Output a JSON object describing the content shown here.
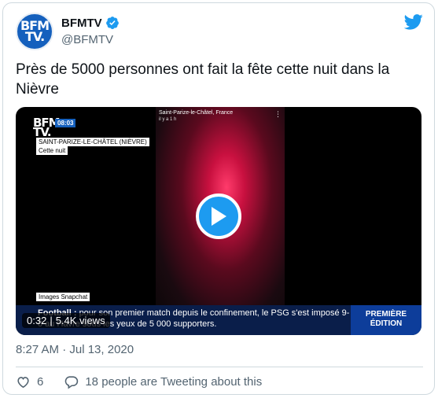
{
  "author": {
    "display_name": "BFMTV",
    "handle": "@BFMTV",
    "avatar_text_line1": "BFM",
    "avatar_text_line2": "TV."
  },
  "tweet": {
    "text": "Près de 5000 personnes ont fait la fête cette nuit dans la Nièvre",
    "timestamp": "8:27 AM · Jul 13, 2020"
  },
  "video": {
    "elapsed": "0:32",
    "views": "5.4K views",
    "overlay": {
      "logo_line1": "BFM",
      "logo_line2": "TV.",
      "clock": "08:03",
      "location": "SAINT-PARIZE-LE-CHÂTEL (NIÈVRE)",
      "time_note": "Cette nuit",
      "credit": "Images Snapchat",
      "snap_location": "Saint-Parize-le-Châtel, France",
      "snap_time": "il y a 1 h",
      "ticker_bold": "Football :",
      "ticker_text": "pour son premier match depuis le confinement, le PSG s'est imposé 9-0 au Havre sous les yeux de 5 000 supporters.",
      "edition_line1": "PREMIÈRE",
      "edition_line2": "ÉDITION"
    }
  },
  "actions": {
    "likes": "6",
    "tweeting": "18 people are Tweeting about this"
  },
  "colors": {
    "twitter_blue": "#1d9bf0",
    "bfm_blue": "#1560bd",
    "muted": "#536471"
  },
  "icons": [
    "verified-badge-icon",
    "twitter-logo-icon",
    "play-icon",
    "heart-icon",
    "speech-bubble-icon"
  ]
}
